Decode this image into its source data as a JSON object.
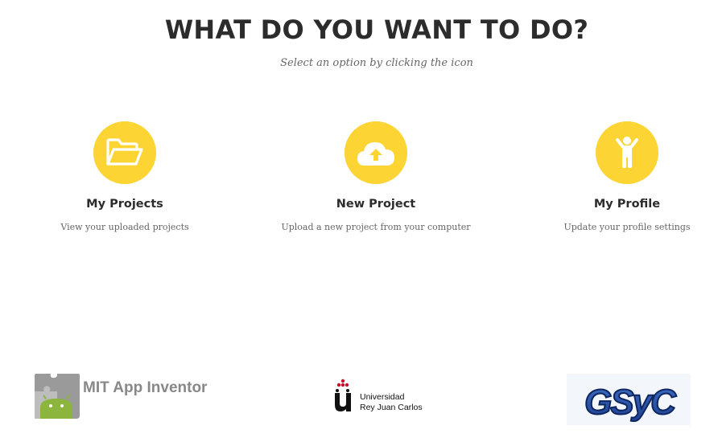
{
  "header": {
    "title": "WHAT DO YOU WANT TO DO?",
    "subtitle": "Select an option by clicking the icon"
  },
  "options": [
    {
      "label": "My Projects",
      "description": "View your uploaded projects",
      "icon": "folder-open-icon"
    },
    {
      "label": "New Project",
      "description": "Upload a new project from your computer",
      "icon": "cloud-upload-icon"
    },
    {
      "label": "My Profile",
      "description": "Update your profile settings",
      "icon": "child-user-icon"
    }
  ],
  "logos": {
    "mit": "MIT App Inventor",
    "urjc_line1": "Universidad",
    "urjc_line2": "Rey Juan Carlos",
    "gsyc": "GSyC"
  },
  "colors": {
    "accent": "#fcd434",
    "title": "#2c2c2c",
    "muted": "#666666"
  }
}
